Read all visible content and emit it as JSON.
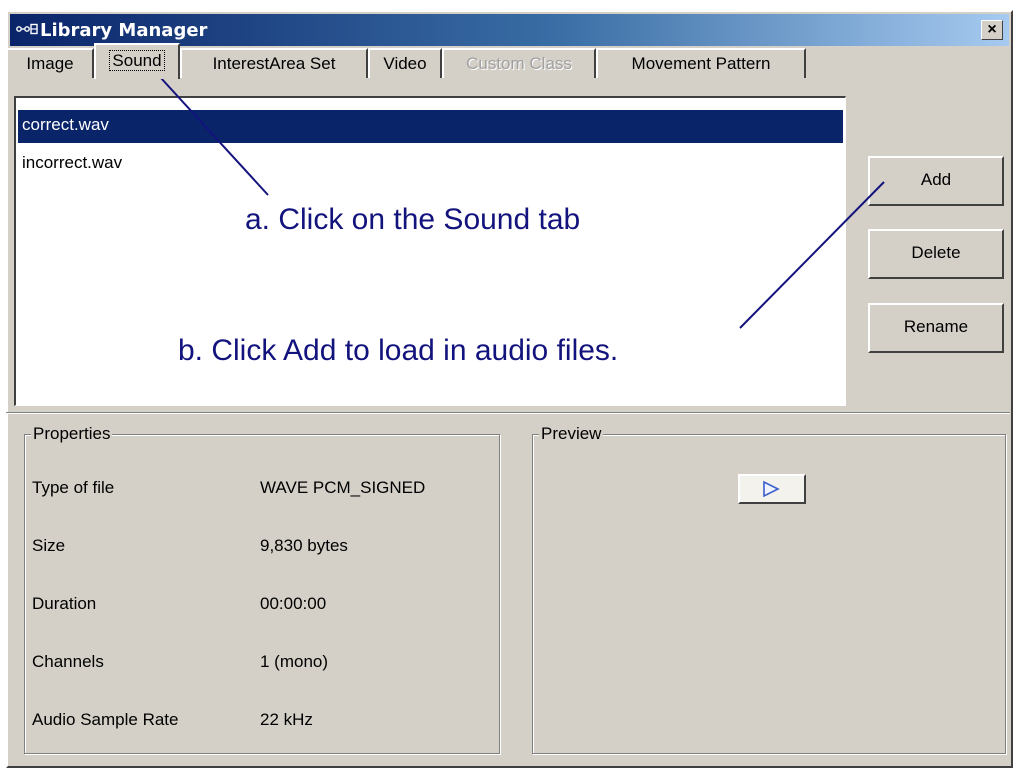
{
  "window": {
    "title": "Library Manager",
    "icon": "library-manager-icon",
    "close_label": "×"
  },
  "tabs": [
    {
      "label": "Image",
      "state": "normal"
    },
    {
      "label": "Sound",
      "state": "active"
    },
    {
      "label": "InterestArea Set",
      "state": "normal"
    },
    {
      "label": "Video",
      "state": "normal"
    },
    {
      "label": "Custom Class",
      "state": "disabled"
    },
    {
      "label": "Movement Pattern",
      "state": "normal"
    }
  ],
  "file_list": {
    "items": [
      {
        "name": "correct.wav",
        "selected": true
      },
      {
        "name": "incorrect.wav",
        "selected": false
      }
    ]
  },
  "buttons": {
    "add": "Add",
    "delete": "Delete",
    "rename": "Rename"
  },
  "properties": {
    "title": "Properties",
    "rows": [
      {
        "name": "Type of file",
        "value": "WAVE PCM_SIGNED"
      },
      {
        "name": "Size",
        "value": "9,830 bytes"
      },
      {
        "name": "Duration",
        "value": "00:00:00"
      },
      {
        "name": "Channels",
        "value": "1 (mono)"
      },
      {
        "name": "Audio Sample Rate",
        "value": "22 kHz"
      }
    ]
  },
  "preview": {
    "title": "Preview",
    "play_icon": "play-icon"
  },
  "annotations": {
    "a": "a. Click on the Sound tab",
    "b": "b. Click Add to load in audio files."
  },
  "colors": {
    "annotation": "#13137d",
    "selection": "#0a246a",
    "titlebar_start": "#0a246a",
    "titlebar_end": "#a6caf0",
    "face": "#d4d0c8"
  }
}
